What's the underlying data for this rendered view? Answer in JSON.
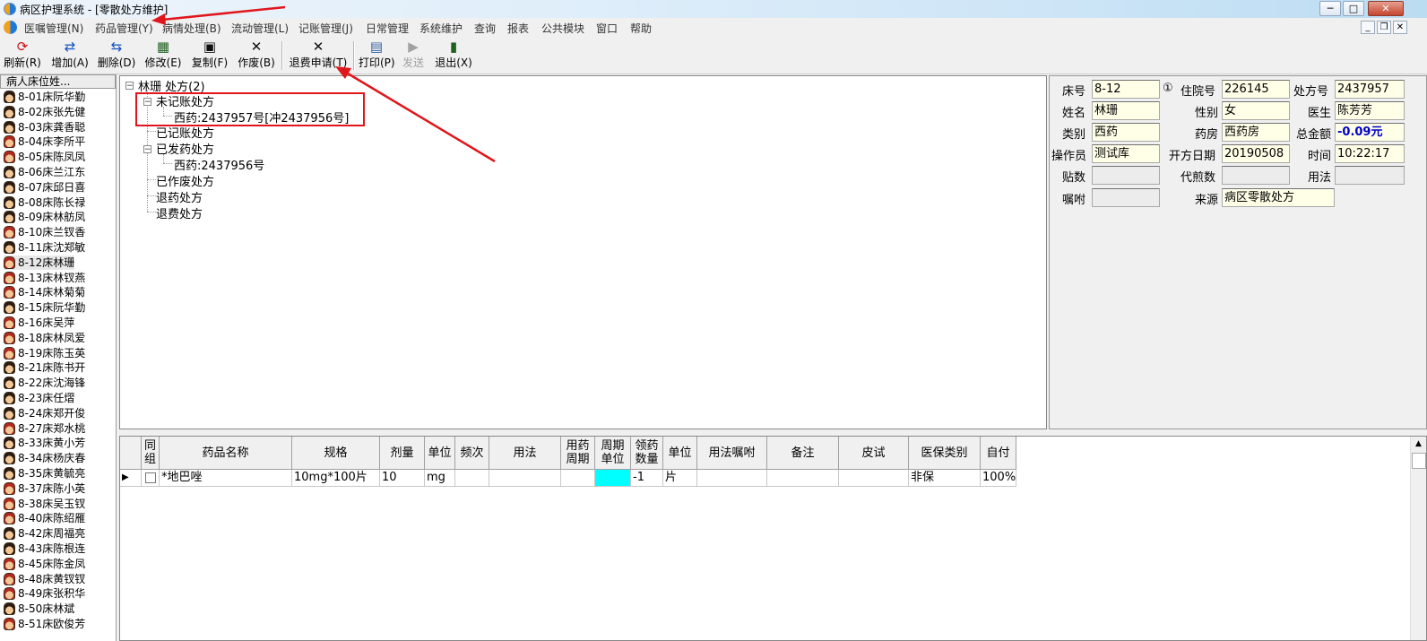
{
  "window": {
    "title": "病区护理系统 - [零散处方维护]",
    "min_label": "─",
    "max_label": "□",
    "close_label": "✕",
    "mdi_min": "_",
    "mdi_restore": "❐",
    "mdi_close": "✕"
  },
  "menu": [
    "医嘱管理(N)",
    "药品管理(Y)",
    "病情处理(B)",
    "流动管理(L)",
    "记账管理(J)",
    "日常管理",
    "系统维护",
    "查询",
    "报表",
    "公共模块",
    "窗口",
    "帮助"
  ],
  "toolbar": [
    {
      "label": "刷新(R)",
      "icon": "refresh-icon",
      "glyph": "⟳",
      "color": "#d0101a"
    },
    {
      "label": "增加(A)",
      "icon": "add-icon",
      "glyph": "⇄",
      "color": "#1050c0"
    },
    {
      "label": "删除(D)",
      "icon": "delete-icon",
      "glyph": "⇆",
      "color": "#1050c0"
    },
    {
      "label": "修改(E)",
      "icon": "edit-icon",
      "glyph": "▦",
      "color": "#206020"
    },
    {
      "label": "复制(F)",
      "icon": "save-icon",
      "glyph": "▣",
      "color": "#101010"
    },
    {
      "label": "作废(B)",
      "icon": "void-icon",
      "glyph": "✕",
      "color": "#101010"
    },
    {
      "label": "退费申请(T)",
      "icon": "refund-icon",
      "glyph": "✕",
      "color": "#101010"
    },
    {
      "label": "打印(P)",
      "icon": "print-icon",
      "glyph": "▤",
      "color": "#3060a0"
    },
    {
      "label": "发送",
      "icon": "send-icon",
      "glyph": "▶",
      "color": "#a0a0a0"
    },
    {
      "label": "退出(X)",
      "icon": "exit-icon",
      "glyph": "▮",
      "color": "#206020"
    }
  ],
  "patients": {
    "header": "病人床位姓...",
    "items": [
      "8-01床阮华勤",
      "8-02床张先健",
      "8-03床龚香聪",
      "8-04床李所平",
      "8-05床陈凤凤",
      "8-06床兰江东",
      "8-07床邱日喜",
      "8-08床陈长禄",
      "8-09床林舫凤",
      "8-10床兰钗香",
      "8-11床沈郑敏",
      "8-12床林珊",
      "8-13床林钗燕",
      "8-14床林菊菊",
      "8-15床阮华勤",
      "8-16床吴萍",
      "8-18床林凤爱",
      "8-19床陈玉英",
      "8-21床陈书开",
      "8-22床沈海锋",
      "8-23床任熠",
      "8-24床郑开俊",
      "8-27床郑水桃",
      "8-33床黄小芳",
      "8-34床杨庆春",
      "8-35床黄毓亮",
      "8-37床陈小英",
      "8-38床吴玉钗",
      "8-40床陈绍雁",
      "8-42床周福亮",
      "8-43床陈根连",
      "8-45床陈金凤",
      "8-48床黄钗钗",
      "8-49床张积华",
      "8-50床林斌",
      "8-51床欧俊芳"
    ],
    "red_faces": [
      3,
      4,
      9,
      11,
      12,
      13,
      15,
      16,
      17,
      22,
      26,
      27,
      28,
      31,
      32,
      33,
      35
    ]
  },
  "tree": {
    "root": "林珊  处方(2)",
    "unbilled": "未记账处方",
    "unbilled_item": "西药:2437957号[冲2437956号]",
    "billed": "已记账处方",
    "dispensed": "已发药处方",
    "dispensed_item": "西药:2437956号",
    "voided": "已作废处方",
    "returned_drug": "退药处方",
    "returned_fee": "退费处方"
  },
  "info": {
    "bed_label": "床号",
    "bed": "8-12",
    "circle": "①",
    "admission_label": "住院号",
    "admission": "226145",
    "rx_label": "处方号",
    "rx": "2437957",
    "name_label": "姓名",
    "name": "林珊",
    "sex_label": "性别",
    "sex": "女",
    "doctor_label": "医生",
    "doctor": "陈芳芳",
    "type_label": "类别",
    "type": "西药",
    "pharmacy_label": "药房",
    "pharmacy": "西药房",
    "total_label": "总金额",
    "total": "-0.09元",
    "operator_label": "操作员",
    "operator": "测试库",
    "date_label": "开方日期",
    "date": "20190508",
    "time_label": "时间",
    "time": "10:22:17",
    "doses_label": "贴数",
    "doses": "",
    "decoct_label": "代煎数",
    "decoct": "",
    "usage_label": "用法",
    "usage": "",
    "advice_label": "嘱咐",
    "advice": "",
    "source_label": "来源",
    "source": "病区零散处方"
  },
  "grid": {
    "headers": [
      "同\n组",
      "药品名称",
      "规格",
      "剂量",
      "单位",
      "频次",
      "用法",
      "用药\n周期",
      "周期\n单位",
      "领药\n数量",
      "单位",
      "用法嘱咐",
      "备注",
      "皮试",
      "医保类别",
      "自付"
    ],
    "rows": [
      [
        "",
        "*地巴唑",
        "10mg*100片",
        "10",
        "mg",
        "",
        "",
        "",
        "",
        "-1",
        "片",
        "",
        "",
        "",
        "非保",
        "100%"
      ]
    ]
  }
}
